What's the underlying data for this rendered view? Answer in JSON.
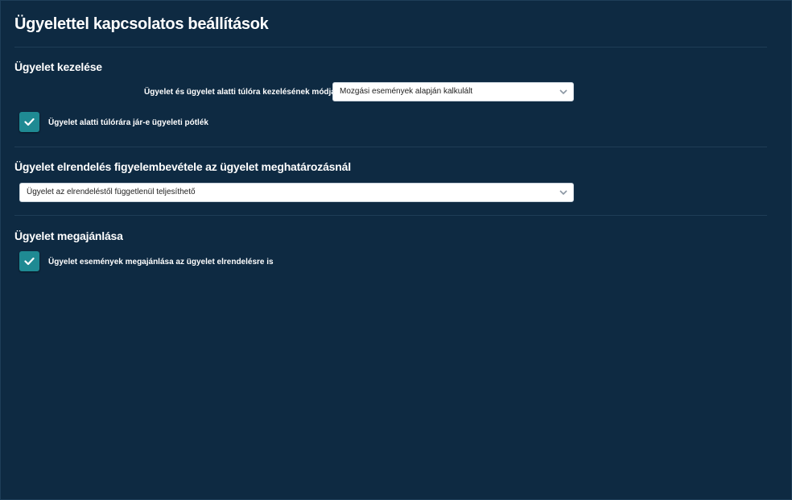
{
  "page": {
    "title": "Ügyelettel kapcsolatos beállítások"
  },
  "section_handling": {
    "title": "Ügyelet kezelése",
    "overtime_mode_label": "Ügyelet és ügyelet alatti túlóra kezelésének módja",
    "overtime_mode_value": "Mozgási események alapján kalkulált",
    "overtime_allowance_label": "Ügyelet alatti túlórára jár-e ügyeleti pótlék",
    "overtime_allowance_checked": true
  },
  "section_order": {
    "title": "Ügyelet elrendelés figyelembevétele az ügyelet meghatározásnál",
    "order_mode_value": "Ügyelet az elrendeléstől függetlenül teljesíthető"
  },
  "section_offer": {
    "title": "Ügyelet megajánlása",
    "offer_label": "Ügyelet események megajánlása az ügyelet elrendelésre is",
    "offer_checked": true
  },
  "colors": {
    "background": "#0e2a42",
    "accent": "#1f8a93"
  }
}
